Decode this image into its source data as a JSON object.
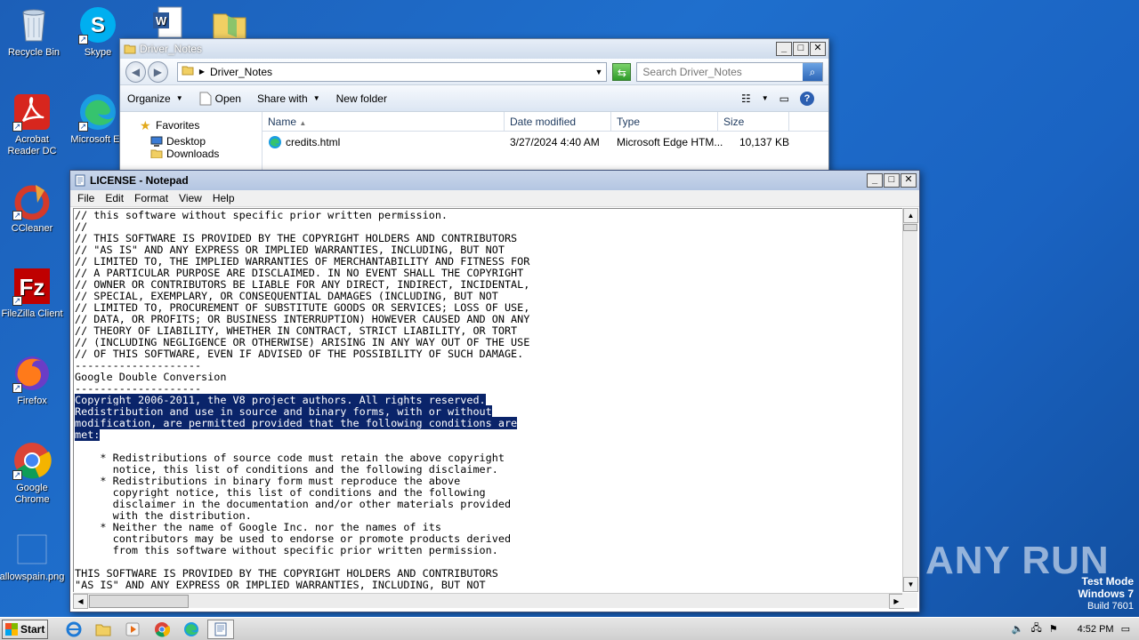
{
  "desktop": {
    "icons": [
      {
        "label": "Recycle Bin"
      },
      {
        "label": "Skype"
      },
      {
        "label": "Acrobat Reader DC"
      },
      {
        "label": "Microsoft Ed"
      },
      {
        "label": "CCleaner"
      },
      {
        "label": "FileZilla Client"
      },
      {
        "label": "Firefox"
      },
      {
        "label": "Google Chrome"
      },
      {
        "label": "allowspain.png"
      }
    ],
    "watermark": "ANY RUN",
    "test_mode": {
      "line1": "Test Mode",
      "line2": "Windows 7",
      "line3": "Build 7601"
    }
  },
  "explorer": {
    "title": "Driver_Notes",
    "address": "Driver_Notes",
    "search_placeholder": "Search Driver_Notes",
    "toolbar": {
      "organize": "Organize",
      "open": "Open",
      "share_with": "Share with",
      "new_folder": "New folder"
    },
    "nav": {
      "favorites": "Favorites",
      "desktop": "Desktop",
      "downloads": "Downloads"
    },
    "columns": {
      "name": "Name",
      "date": "Date modified",
      "type": "Type",
      "size": "Size"
    },
    "files": [
      {
        "name": "credits.html",
        "date": "3/27/2024 4:40 AM",
        "type": "Microsoft Edge HTM...",
        "size": "10,137 KB"
      }
    ]
  },
  "notepad": {
    "title": "LICENSE - Notepad",
    "menu": {
      "file": "File",
      "edit": "Edit",
      "format": "Format",
      "view": "View",
      "help": "Help"
    },
    "lines": [
      "// this software without specific prior written permission.",
      "//",
      "// THIS SOFTWARE IS PROVIDED BY THE COPYRIGHT HOLDERS AND CONTRIBUTORS",
      "// \"AS IS\" AND ANY EXPRESS OR IMPLIED WARRANTIES, INCLUDING, BUT NOT",
      "// LIMITED TO, THE IMPLIED WARRANTIES OF MERCHANTABILITY AND FITNESS FOR",
      "// A PARTICULAR PURPOSE ARE DISCLAIMED. IN NO EVENT SHALL THE COPYRIGHT",
      "// OWNER OR CONTRIBUTORS BE LIABLE FOR ANY DIRECT, INDIRECT, INCIDENTAL,",
      "// SPECIAL, EXEMPLARY, OR CONSEQUENTIAL DAMAGES (INCLUDING, BUT NOT",
      "// LIMITED TO, PROCUREMENT OF SUBSTITUTE GOODS OR SERVICES; LOSS OF USE,",
      "// DATA, OR PROFITS; OR BUSINESS INTERRUPTION) HOWEVER CAUSED AND ON ANY",
      "// THEORY OF LIABILITY, WHETHER IN CONTRACT, STRICT LIABILITY, OR TORT",
      "// (INCLUDING NEGLIGENCE OR OTHERWISE) ARISING IN ANY WAY OUT OF THE USE",
      "// OF THIS SOFTWARE, EVEN IF ADVISED OF THE POSSIBILITY OF SUCH DAMAGE.",
      "--------------------",
      "Google Double Conversion",
      "--------------------",
      "Copyright 2006-2011, the V8 project authors. All rights reserved.",
      "Redistribution and use in source and binary forms, with or without",
      "modification, are permitted provided that the following conditions are",
      "met:",
      "",
      "    * Redistributions of source code must retain the above copyright",
      "      notice, this list of conditions and the following disclaimer.",
      "    * Redistributions in binary form must reproduce the above",
      "      copyright notice, this list of conditions and the following",
      "      disclaimer in the documentation and/or other materials provided",
      "      with the distribution.",
      "    * Neither the name of Google Inc. nor the names of its",
      "      contributors may be used to endorse or promote products derived",
      "      from this software without specific prior written permission.",
      "",
      "THIS SOFTWARE IS PROVIDED BY THE COPYRIGHT HOLDERS AND CONTRIBUTORS",
      "\"AS IS\" AND ANY EXPRESS OR IMPLIED WARRANTIES, INCLUDING, BUT NOT"
    ],
    "selected_lines": [
      16,
      17,
      18,
      19
    ]
  },
  "taskbar": {
    "start": "Start",
    "clock": "4:52 PM"
  }
}
